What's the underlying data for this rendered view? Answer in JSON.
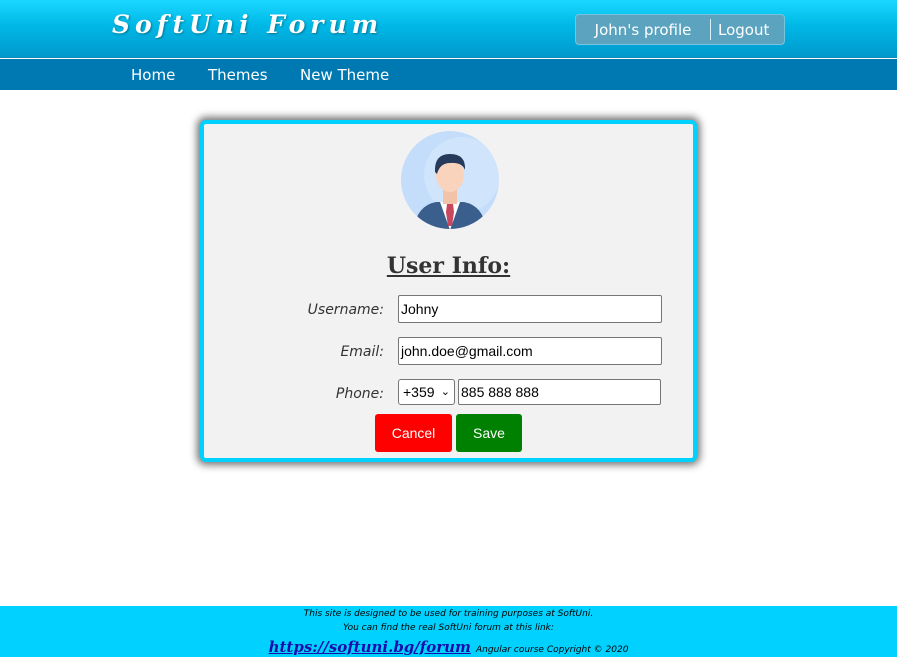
{
  "header": {
    "logo": "SoftUni Forum",
    "profile_label": "John's profile",
    "logout_label": "Logout"
  },
  "nav": {
    "home": "Home",
    "themes": "Themes",
    "new_theme": "New Theme"
  },
  "profile_card": {
    "avatar_icon": "user-avatar-icon",
    "title": "User Info:",
    "username_label": "Username:",
    "username_value": "Johny",
    "email_label": "Email:",
    "email_value": "john.doe@gmail.com",
    "phone_label": "Phone:",
    "phone_code": "+359",
    "phone_value": "885 888 888",
    "cancel_label": "Cancel",
    "save_label": "Save"
  },
  "footer": {
    "line1": "This site is designed to be used for training purposes at SoftUni.",
    "line2": "You can find the real SoftUni forum at this link:",
    "link": "https://softuni.bg/forum",
    "copyright": "Angular course Copyright © 2020"
  },
  "colors": {
    "accent": "#00d1ff",
    "nav_bar": "#0079b3",
    "cancel": "#ff0000",
    "save": "#008000"
  }
}
